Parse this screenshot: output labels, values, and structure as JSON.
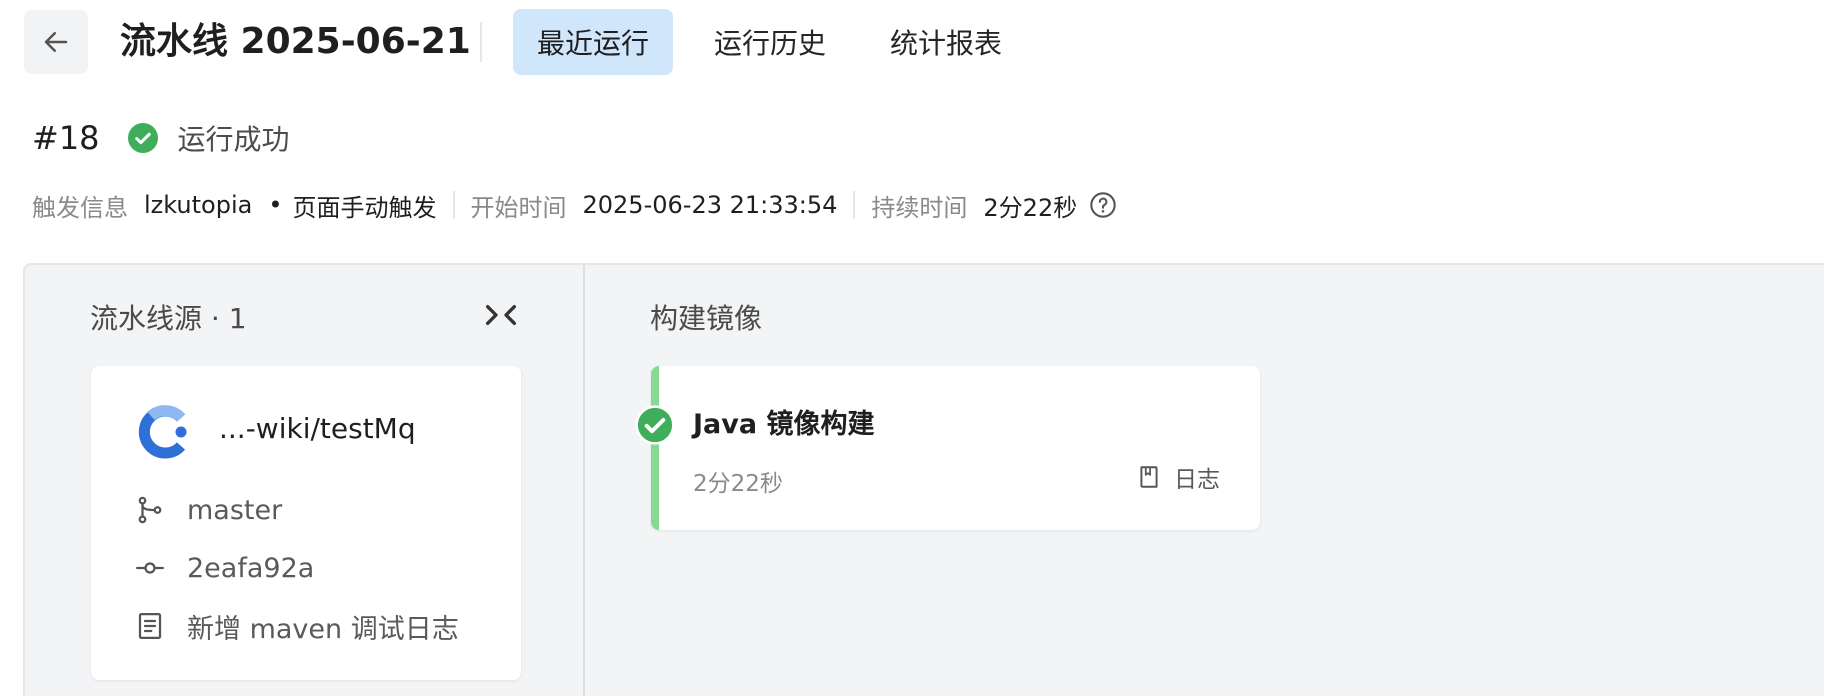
{
  "header": {
    "title": "流水线 2025-06-21",
    "tabs": [
      {
        "label": "最近运行",
        "active": true
      },
      {
        "label": "运行历史",
        "active": false
      },
      {
        "label": "统计报表",
        "active": false
      }
    ]
  },
  "run": {
    "number": "#18",
    "status": "运行成功",
    "status_color": "#3fae5a"
  },
  "meta": {
    "trigger_label": "触发信息",
    "trigger_user": "lzkutopia",
    "trigger_type": "页面手动触发",
    "start_label": "开始时间",
    "start_time": "2025-06-23 21:33:54",
    "duration_label": "持续时间",
    "duration": "2分22秒"
  },
  "pipeline": {
    "source": {
      "title": "流水线源 · 1",
      "repo": "...-wiki/testMq",
      "branch": "master",
      "commit": "2eafa92a",
      "message": "新增 maven 调试日志"
    },
    "stage": {
      "title": "构建镜像",
      "job": {
        "name": "Java 镜像构建",
        "duration": "2分22秒",
        "log_label": "日志",
        "accent_color": "#86d993"
      }
    }
  },
  "colors": {
    "accent_tab_bg": "#cfe6fb",
    "success": "#3fae5a"
  }
}
